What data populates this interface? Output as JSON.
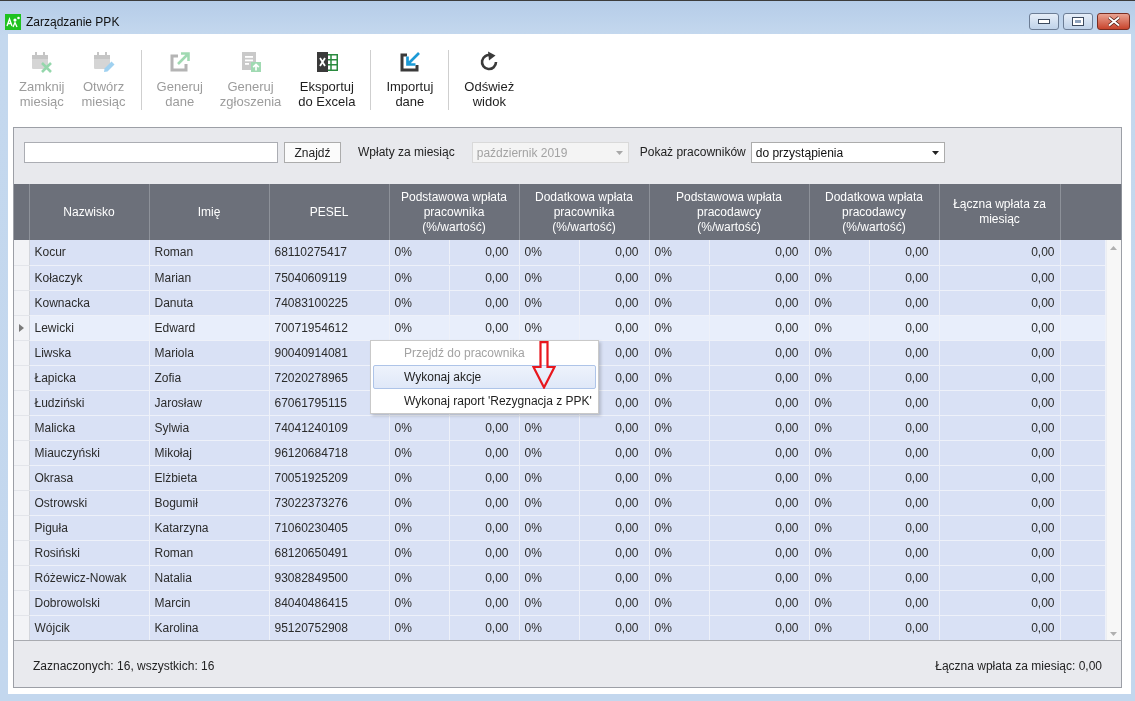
{
  "window": {
    "title": "Zarządzanie PPK"
  },
  "toolbar": {
    "groups": [
      [
        {
          "kind": "close",
          "label": "Zamknij\nmiesiąc",
          "disabled": true
        },
        {
          "kind": "reopen",
          "label": "Otwórz\nmiesiąc",
          "disabled": true
        }
      ],
      [
        {
          "kind": "generate",
          "label": "Generuj\ndane",
          "disabled": true
        },
        {
          "kind": "submissions",
          "label": "Generuj\nzgłoszenia",
          "disabled": true
        },
        {
          "kind": "excel",
          "label": "Eksportuj\ndo Excela",
          "disabled": false
        }
      ],
      [
        {
          "kind": "import",
          "label": "Importuj\ndane",
          "disabled": false
        }
      ],
      [
        {
          "kind": "refresh",
          "label": "Odśwież\nwidok",
          "disabled": false
        }
      ]
    ]
  },
  "filters": {
    "search": {
      "button": "Znajdź"
    },
    "month": {
      "label": "Wpłaty za miesiąc",
      "value": "październik 2019",
      "disabled": true
    },
    "employees": {
      "label": "Pokaż pracowników",
      "value": "do przystąpienia",
      "disabled": false
    }
  },
  "table": {
    "columns": [
      {
        "label": "Nazwisko",
        "kind": "text"
      },
      {
        "label": "Imię",
        "kind": "text"
      },
      {
        "label": "PESEL",
        "kind": "text"
      },
      {
        "label": "Podstawowa wpłata\npracownika\n(%/wartość)",
        "kind": "pair"
      },
      {
        "label": "Dodatkowa wpłata\npracownika\n(%/wartość)",
        "kind": "pair"
      },
      {
        "label": "Podstawowa wpłata\npracodawcy\n(%/wartość)",
        "kind": "pair"
      },
      {
        "label": "Dodatkowa wpłata\npracodawcy\n(%/wartość)",
        "kind": "pair"
      },
      {
        "label": "Łączna wpłata za\nmiesiąc",
        "kind": "amount"
      }
    ],
    "rows": [
      {
        "cells": [
          "Kocur",
          "Roman",
          "68110275417",
          [
            "0%",
            "0,00"
          ],
          [
            "0%",
            "0,00"
          ],
          [
            "0%",
            "0,00"
          ],
          [
            "0%",
            "0,00"
          ],
          "0,00"
        ],
        "selected": true,
        "current": false
      },
      {
        "cells": [
          "Kołaczyk",
          "Marian",
          "75040609119",
          [
            "0%",
            "0,00"
          ],
          [
            "0%",
            "0,00"
          ],
          [
            "0%",
            "0,00"
          ],
          [
            "0%",
            "0,00"
          ],
          "0,00"
        ],
        "selected": true,
        "current": false
      },
      {
        "cells": [
          "Kownacka",
          "Danuta",
          "74083100225",
          [
            "0%",
            "0,00"
          ],
          [
            "0%",
            "0,00"
          ],
          [
            "0%",
            "0,00"
          ],
          [
            "0%",
            "0,00"
          ],
          "0,00"
        ],
        "selected": true,
        "current": false
      },
      {
        "cells": [
          "Lewicki",
          "Edward",
          "70071954612",
          [
            "0%",
            "0,00"
          ],
          [
            "0%",
            "0,00"
          ],
          [
            "0%",
            "0,00"
          ],
          [
            "0%",
            "0,00"
          ],
          "0,00"
        ],
        "selected": true,
        "current": true
      },
      {
        "cells": [
          "Liwska",
          "Mariola",
          "90040914081",
          [
            null,
            null
          ],
          [
            null,
            "0,00"
          ],
          [
            "0%",
            "0,00"
          ],
          [
            "0%",
            "0,00"
          ],
          "0,00"
        ],
        "selected": true,
        "current": false
      },
      {
        "cells": [
          "Łapicka",
          "Zofia",
          "72020278965",
          [
            null,
            null
          ],
          [
            null,
            "0,00"
          ],
          [
            "0%",
            "0,00"
          ],
          [
            "0%",
            "0,00"
          ],
          "0,00"
        ],
        "selected": true,
        "current": false
      },
      {
        "cells": [
          "Łudziński",
          "Jarosław",
          "67061795115",
          [
            null,
            null
          ],
          [
            null,
            "0,00"
          ],
          [
            "0%",
            "0,00"
          ],
          [
            "0%",
            "0,00"
          ],
          "0,00"
        ],
        "selected": true,
        "current": false
      },
      {
        "cells": [
          "Malicka",
          "Sylwia",
          "74041240109",
          [
            "0%",
            "0,00"
          ],
          [
            "0%",
            "0,00"
          ],
          [
            "0%",
            "0,00"
          ],
          [
            "0%",
            "0,00"
          ],
          "0,00"
        ],
        "selected": true,
        "current": false
      },
      {
        "cells": [
          "Miauczyński",
          "Mikołaj",
          "96120684718",
          [
            "0%",
            "0,00"
          ],
          [
            "0%",
            "0,00"
          ],
          [
            "0%",
            "0,00"
          ],
          [
            "0%",
            "0,00"
          ],
          "0,00"
        ],
        "selected": true,
        "current": false
      },
      {
        "cells": [
          "Okrasa",
          "Elżbieta",
          "70051925209",
          [
            "0%",
            "0,00"
          ],
          [
            "0%",
            "0,00"
          ],
          [
            "0%",
            "0,00"
          ],
          [
            "0%",
            "0,00"
          ],
          "0,00"
        ],
        "selected": true,
        "current": false
      },
      {
        "cells": [
          "Ostrowski",
          "Bogumił",
          "73022373276",
          [
            "0%",
            "0,00"
          ],
          [
            "0%",
            "0,00"
          ],
          [
            "0%",
            "0,00"
          ],
          [
            "0%",
            "0,00"
          ],
          "0,00"
        ],
        "selected": true,
        "current": false
      },
      {
        "cells": [
          "Piguła",
          "Katarzyna",
          "71060230405",
          [
            "0%",
            "0,00"
          ],
          [
            "0%",
            "0,00"
          ],
          [
            "0%",
            "0,00"
          ],
          [
            "0%",
            "0,00"
          ],
          "0,00"
        ],
        "selected": true,
        "current": false
      },
      {
        "cells": [
          "Rosiński",
          "Roman",
          "68120650491",
          [
            "0%",
            "0,00"
          ],
          [
            "0%",
            "0,00"
          ],
          [
            "0%",
            "0,00"
          ],
          [
            "0%",
            "0,00"
          ],
          "0,00"
        ],
        "selected": true,
        "current": false
      },
      {
        "cells": [
          "Różewicz-Nowak",
          "Natalia",
          "93082849500",
          [
            "0%",
            "0,00"
          ],
          [
            "0%",
            "0,00"
          ],
          [
            "0%",
            "0,00"
          ],
          [
            "0%",
            "0,00"
          ],
          "0,00"
        ],
        "selected": true,
        "current": false
      },
      {
        "cells": [
          "Dobrowolski",
          "Marcin",
          "84040486415",
          [
            "0%",
            "0,00"
          ],
          [
            "0%",
            "0,00"
          ],
          [
            "0%",
            "0,00"
          ],
          [
            "0%",
            "0,00"
          ],
          "0,00"
        ],
        "selected": true,
        "current": false
      },
      {
        "cells": [
          "Wójcik",
          "Karolina",
          "95120752908",
          [
            "0%",
            "0,00"
          ],
          [
            "0%",
            "0,00"
          ],
          [
            "0%",
            "0,00"
          ],
          [
            "0%",
            "0,00"
          ],
          "0,00"
        ],
        "selected": true,
        "current": false
      }
    ]
  },
  "context_menu": {
    "items": [
      {
        "label": "Przejdź do pracownika",
        "disabled": true,
        "selected": false
      },
      {
        "label": "Wykonaj akcje",
        "disabled": false,
        "selected": true
      },
      {
        "label": "Wykonaj raport 'Rezygnacja z PPK'",
        "disabled": false,
        "selected": false
      }
    ]
  },
  "status_bar": {
    "selection": "Zaznaczonych: 16, wszystkich: 16",
    "total": "Łączna wpłata za miesiąc: 0,00"
  }
}
